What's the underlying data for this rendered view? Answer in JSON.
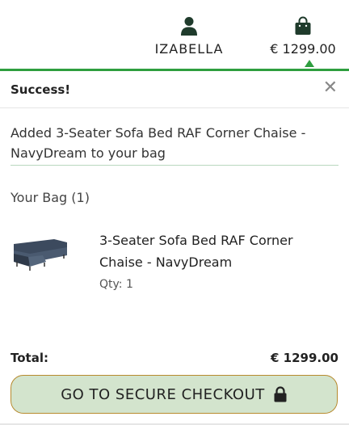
{
  "header": {
    "account_label": "IZABELLA",
    "account_icon": "user-icon",
    "bag_total": "€ 1299.00",
    "bag_icon": "shopping-bag-icon",
    "accent_color": "#2e9e3f"
  },
  "toast": {
    "title": "Success!",
    "close_icon": "close-icon",
    "message": "Added 3-Seater Sofa Bed RAF Corner Chaise - NavyDream to your bag",
    "bag_heading": "Your Bag (1)",
    "items": [
      {
        "name": "3-Seater Sofa Bed RAF Corner Chaise - NavyDream",
        "qty": "Qty: 1",
        "image": "sofa-thumbnail"
      }
    ],
    "total_label": "Total:",
    "total_value": "€ 1299.00",
    "checkout_label": "GO TO SECURE CHECKOUT",
    "checkout_icon": "lock-icon",
    "checkout_bg": "#d3e4cd"
  }
}
